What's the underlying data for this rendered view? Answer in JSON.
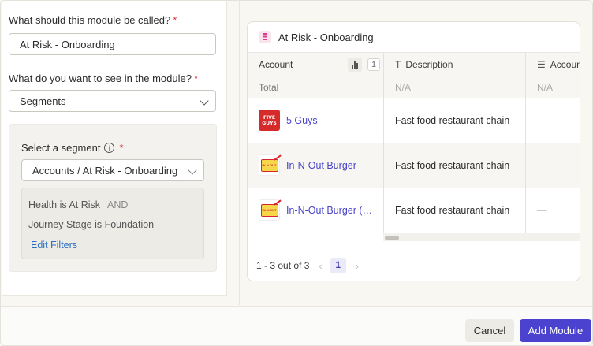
{
  "form": {
    "name_question": "What should this module be called?",
    "name_value": "At Risk - Onboarding",
    "see_question": "What do you want to see in the module?",
    "see_value": "Segments",
    "required_mark": "*",
    "segment_label": "Select a segment",
    "info_glyph": "i",
    "segment_value": "Accounts / At Risk - Onboarding",
    "filter_1": "Health is At Risk",
    "filter_1_op": "AND",
    "filter_2": "Journey Stage is Foundation",
    "edit_filters": "Edit Filters"
  },
  "preview": {
    "title": "At Risk - Onboarding",
    "columns": {
      "account": "Account",
      "account_count": "1",
      "description": "Description",
      "account_more": "Accoun"
    },
    "total": {
      "label": "Total",
      "description": "N/A",
      "account_more": "N/A"
    },
    "rows": [
      {
        "account": "5 Guys",
        "logo": "FIVE GUYS",
        "description": "Fast food restaurant chain",
        "extra": "—"
      },
      {
        "account": "In-N-Out Burger",
        "logo": "IN-N-OUT",
        "description": "Fast food restaurant chain",
        "extra": "—"
      },
      {
        "account": "In-N-Out Burger (…",
        "logo": "IN-N-OUT",
        "description": "Fast food restaurant chain",
        "extra": "—"
      }
    ],
    "pager": {
      "summary": "1 - 3 out of 3",
      "prev": "‹",
      "page": "1",
      "next": "›"
    }
  },
  "footer": {
    "cancel_label": "Cancel",
    "add_label": "Add Module"
  },
  "colors": {
    "accent": "#4b43cf",
    "link": "#4a45c8",
    "required": "#d9353a",
    "edit_link": "#2d6fc1"
  },
  "icons": [
    "info-icon",
    "chevron-down-icon",
    "module-icon",
    "bar-chart-icon",
    "text-type-icon",
    "list-icon",
    "chevron-left-icon",
    "chevron-right-icon"
  ]
}
